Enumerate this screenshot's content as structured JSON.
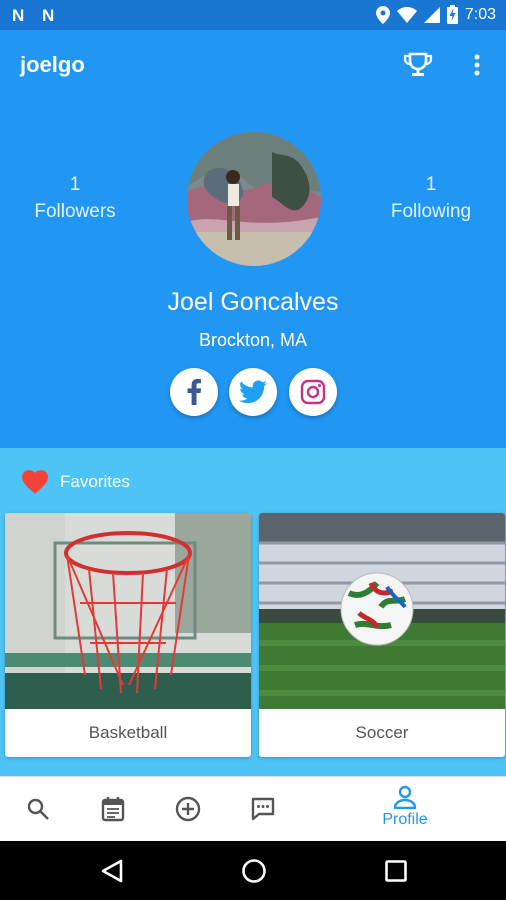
{
  "status_bar": {
    "time": "7:03",
    "left_icons": [
      "n-icon",
      "n-icon"
    ],
    "right_icons": [
      "location-icon",
      "wifi-icon",
      "signal-icon",
      "battery-charging-icon"
    ]
  },
  "app_bar": {
    "title": "joelgo",
    "actions": [
      "trophy-icon",
      "more-vert-icon"
    ]
  },
  "profile": {
    "followers": {
      "count": "1",
      "label": "Followers"
    },
    "following": {
      "count": "1",
      "label": "Following"
    },
    "name": "Joel Goncalves",
    "location": "Brockton, MA",
    "social": [
      "facebook-icon",
      "twitter-icon",
      "instagram-icon"
    ]
  },
  "favorites": {
    "title": "Favorites",
    "items": [
      {
        "label": "Basketball"
      },
      {
        "label": "Soccer"
      }
    ]
  },
  "bottom_nav": {
    "items": [
      "search-icon",
      "calendar-icon",
      "add-circle-icon",
      "chat-icon"
    ],
    "active": {
      "icon": "person-icon",
      "label": "Profile"
    }
  },
  "system_nav": [
    "back-icon",
    "home-icon",
    "recents-icon"
  ],
  "colors": {
    "primary": "#2196f3",
    "primary_dark": "#1976d2",
    "favorites_bg": "#4dc3f7",
    "heart": "#f44336",
    "instagram": "#c13584",
    "facebook": "#3b5998",
    "twitter": "#1da1f2"
  }
}
